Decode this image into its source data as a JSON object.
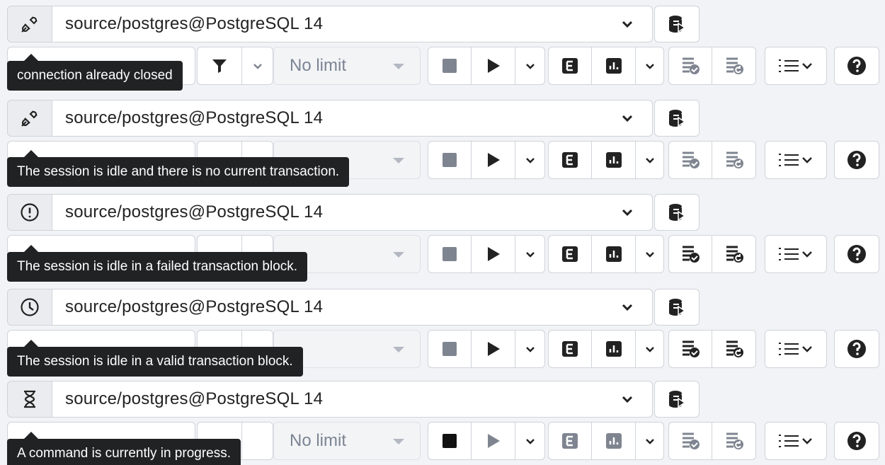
{
  "connection_label": "source/postgres@PostgreSQL 14",
  "limit_text": "No limit",
  "colors": {
    "tooltip_bg": "#202224",
    "border": "#cfd3da",
    "icon_dark": "#222222",
    "icon_gray": "#7f8590"
  },
  "sections": [
    {
      "status_icon": "disconnected-plug-icon",
      "tooltip": "connection already closed",
      "limit_visible": true
    },
    {
      "status_icon": "disconnected-plug-icon",
      "tooltip": "The session is idle and there is no current transaction.",
      "limit_visible": false
    },
    {
      "status_icon": "exclamation-circle-icon",
      "tooltip": "The session is idle in a failed transaction block.",
      "limit_visible": false
    },
    {
      "status_icon": "clock-icon",
      "tooltip": "The session is idle in a valid transaction block.",
      "limit_visible": false
    },
    {
      "status_icon": "hourglass-icon",
      "tooltip": "A command is currently in progress.",
      "limit_visible": true
    }
  ]
}
